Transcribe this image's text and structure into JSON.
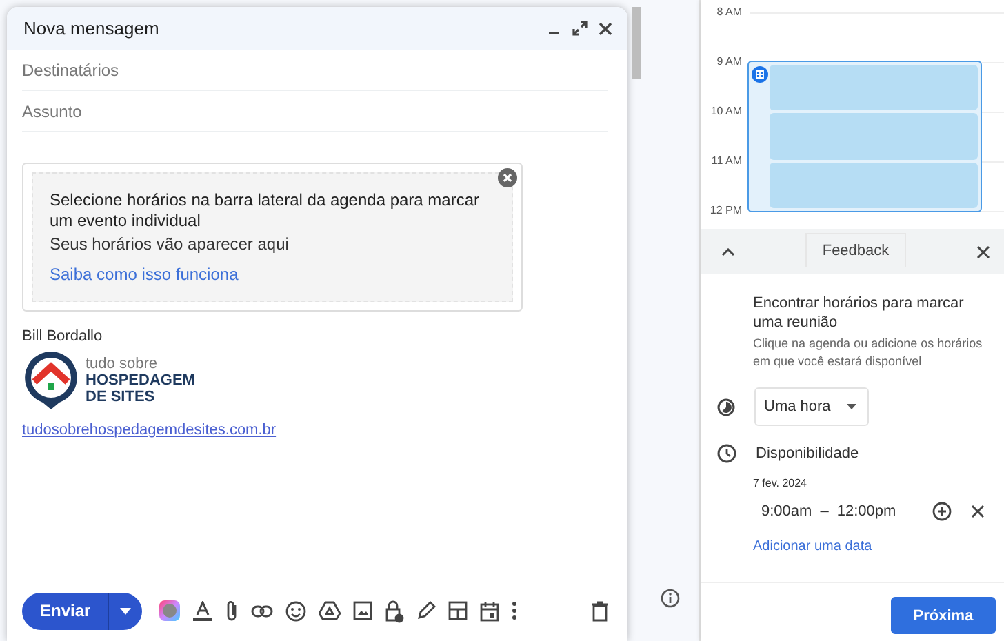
{
  "compose": {
    "title": "Nova mensagem",
    "recipients": {
      "placeholder": "Destinatários"
    },
    "subject": {
      "placeholder": "Assunto"
    },
    "notice": {
      "title": "Selecione horários na barra lateral da agenda para marcar um evento individual",
      "subtitle": "Seus horários vão aparecer aqui",
      "link": "Saiba como isso funciona"
    },
    "signature": {
      "name": "Bill Bordallo",
      "logo_small": "tudo sobre",
      "logo_line1": "HOSPEDAGEM",
      "logo_line2": "DE SITES",
      "url": "tudosobrehospedagemdesites.com.br"
    },
    "send_button": "Enviar"
  },
  "calendar": {
    "hours": [
      "8 AM",
      "9 AM",
      "10 AM",
      "11 AM",
      "12 PM"
    ]
  },
  "panel": {
    "feedback": "Feedback",
    "heading": "Encontrar horários para marcar uma reunião",
    "description": "Clique na agenda ou adicione os horários em que você estará disponível",
    "duration": "Uma hora",
    "availability_label": "Disponibilidade",
    "date": "7 fev. 2024",
    "start": "9:00am",
    "dash": "–",
    "end": "12:00pm",
    "add_date": "Adicionar uma data",
    "next_button": "Próxima"
  }
}
